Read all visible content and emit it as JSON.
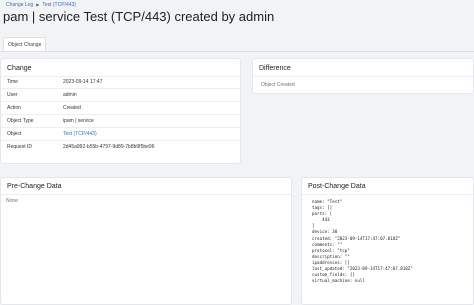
{
  "breadcrumb": {
    "root": "Change Log",
    "current": "Test (TCP/443)"
  },
  "page_title": "pam | service Test (TCP/443) created by admin",
  "tabs": [
    {
      "label": "Object Change"
    }
  ],
  "change": {
    "heading": "Change",
    "rows": [
      {
        "key": "Time",
        "value": "2023-09-14 17:47"
      },
      {
        "key": "User",
        "value": "admin"
      },
      {
        "key": "Action",
        "value": "Created"
      },
      {
        "key": "Object Type",
        "value": "ipam | service"
      },
      {
        "key": "Object",
        "value": "Test (TCP/443)"
      },
      {
        "key": "Request ID",
        "value": "2d45a992-b55b-4797-9d89-7b8b9f5be96"
      }
    ]
  },
  "difference": {
    "heading": "Difference",
    "text": "Object Created"
  },
  "pre_change": {
    "heading": "Pre-Change Data",
    "text": "None"
  },
  "post_change": {
    "heading": "Post-Change Data",
    "lines": [
      "name: \"Test\"",
      "tags: []",
      "ports: [",
      "    443",
      "]",
      "device: 38",
      "created: \"2023-09-14T17:47:07.818Z\"",
      "comments: \"\"",
      "protocol: \"tcp\"",
      "description: \"\"",
      "ipaddresses: []",
      "last_updated: \"2023-09-14T17:47:07.818Z\"",
      "custom_fields: {}",
      "virtual_machine: null"
    ]
  },
  "colors": {
    "link": "#3b6fb6",
    "background": "#f2f3f5",
    "card": "#ffffff"
  }
}
